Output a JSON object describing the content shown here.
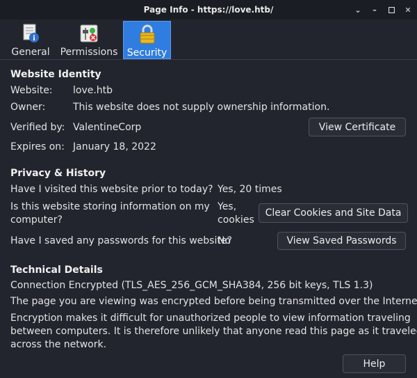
{
  "window": {
    "title": "Page Info - https://love.htb/"
  },
  "tabs": [
    {
      "label": "General",
      "icon": "document-info-icon"
    },
    {
      "label": "Permissions",
      "icon": "permissions-toggle-icon"
    },
    {
      "label": "Security",
      "icon": "padlock-icon",
      "active": true
    }
  ],
  "identity": {
    "heading": "Website Identity",
    "website_label": "Website:",
    "website_value": "love.htb",
    "owner_label": "Owner:",
    "owner_value": "This website does not supply ownership information.",
    "verified_label": "Verified by:",
    "verified_value": "ValentineCorp",
    "expires_label": "Expires on:",
    "expires_value": "January 18, 2022",
    "view_cert_button": "View Certificate"
  },
  "privacy": {
    "heading": "Privacy & History",
    "q1": "Have I visited this website prior to today?",
    "a1": "Yes, 20 times",
    "q2_line1": "Is this website storing information on my",
    "q2_line2": "computer?",
    "a2_line1": "Yes,",
    "a2_line2": "cookies",
    "clear_button": "Clear Cookies and Site Data",
    "q3": "Have I saved any passwords for this website?",
    "a3": "No",
    "passwords_button": "View Saved Passwords"
  },
  "technical": {
    "heading": "Technical Details",
    "line1": "Connection Encrypted (TLS_AES_256_GCM_SHA384, 256 bit keys, TLS 1.3)",
    "line2": "The page you are viewing was encrypted before being transmitted over the Internet.",
    "line3a": "Encryption makes it difficult for unauthorized people to view information traveling",
    "line3b": "between computers. It is therefore unlikely that anyone read this page as it traveled",
    "line3c": "across the network."
  },
  "help_button": "Help",
  "colors": {
    "background": "#23252e",
    "titlebar": "#1b1d24",
    "active_tab": "#2f7de0"
  }
}
